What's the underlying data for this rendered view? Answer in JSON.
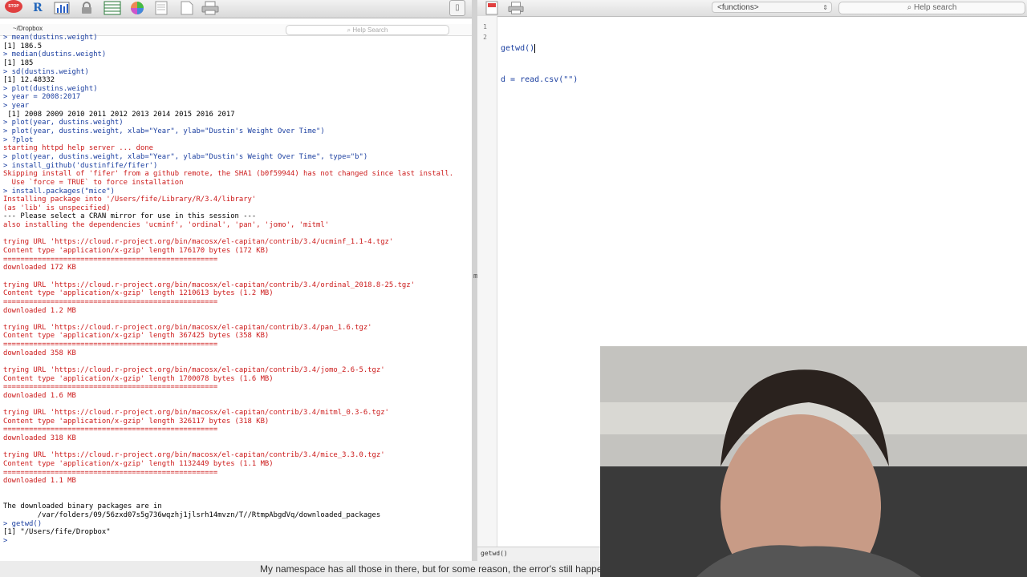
{
  "console_window": {
    "toolbar": {
      "icons": [
        "stop-icon",
        "r-logo-icon",
        "bar-chart-icon",
        "lock-icon",
        "table-icon",
        "color-wheel-icon",
        "script-icon",
        "new-document-icon",
        "print-icon"
      ],
      "stop_label": "STOP",
      "r_label": "R"
    },
    "path": "~/Dropbox",
    "help_search_placeholder": "Help Search",
    "lines": [
      {
        "t": "> mean(dustins.weight)",
        "k": "in"
      },
      {
        "t": "[1] 186.5",
        "k": "out"
      },
      {
        "t": "> median(dustins.weight)",
        "k": "in"
      },
      {
        "t": "[1] 185",
        "k": "out"
      },
      {
        "t": "> sd(dustins.weight)",
        "k": "in"
      },
      {
        "t": "[1] 12.48332",
        "k": "out"
      },
      {
        "t": "> plot(dustins.weight)",
        "k": "in"
      },
      {
        "t": "> year = 2008:2017",
        "k": "in"
      },
      {
        "t": "> year",
        "k": "in"
      },
      {
        "t": " [1] 2008 2009 2010 2011 2012 2013 2014 2015 2016 2017",
        "k": "out"
      },
      {
        "t": "> plot(year, dustins.weight)",
        "k": "in"
      },
      {
        "t": "> plot(year, dustins.weight, xlab=\"Year\", ylab=\"Dustin's Weight Over Time\")",
        "k": "in"
      },
      {
        "t": "> ?plot",
        "k": "in"
      },
      {
        "t": "starting httpd help server ... done",
        "k": "err"
      },
      {
        "t": "> plot(year, dustins.weight, xlab=\"Year\", ylab=\"Dustin's Weight Over Time\", type=\"b\")",
        "k": "in"
      },
      {
        "t": "> install_github('dustinfife/fifer')",
        "k": "in"
      },
      {
        "t": "Skipping install of 'fifer' from a github remote, the SHA1 (b0f59944) has not changed since last install.",
        "k": "err"
      },
      {
        "t": "  Use `force = TRUE` to force installation",
        "k": "err"
      },
      {
        "t": "> install.packages(\"mice\")",
        "k": "in"
      },
      {
        "t": "Installing package into '/Users/fife/Library/R/3.4/library'",
        "k": "err"
      },
      {
        "t": "(as 'lib' is unspecified)",
        "k": "err"
      },
      {
        "t": "--- Please select a CRAN mirror for use in this session ---",
        "k": "out"
      },
      {
        "t": "also installing the dependencies 'ucminf', 'ordinal', 'pan', 'jomo', 'mitml'",
        "k": "err"
      },
      {
        "t": "",
        "k": "out"
      },
      {
        "t": "trying URL 'https://cloud.r-project.org/bin/macosx/el-capitan/contrib/3.4/ucminf_1.1-4.tgz'",
        "k": "err"
      },
      {
        "t": "Content type 'application/x-gzip' length 176170 bytes (172 KB)",
        "k": "err"
      },
      {
        "t": "==================================================",
        "k": "err"
      },
      {
        "t": "downloaded 172 KB",
        "k": "err"
      },
      {
        "t": "",
        "k": "out"
      },
      {
        "t": "trying URL 'https://cloud.r-project.org/bin/macosx/el-capitan/contrib/3.4/ordinal_2018.8-25.tgz'",
        "k": "err"
      },
      {
        "t": "Content type 'application/x-gzip' length 1210613 bytes (1.2 MB)",
        "k": "err"
      },
      {
        "t": "==================================================",
        "k": "err"
      },
      {
        "t": "downloaded 1.2 MB",
        "k": "err"
      },
      {
        "t": "",
        "k": "out"
      },
      {
        "t": "trying URL 'https://cloud.r-project.org/bin/macosx/el-capitan/contrib/3.4/pan_1.6.tgz'",
        "k": "err"
      },
      {
        "t": "Content type 'application/x-gzip' length 367425 bytes (358 KB)",
        "k": "err"
      },
      {
        "t": "==================================================",
        "k": "err"
      },
      {
        "t": "downloaded 358 KB",
        "k": "err"
      },
      {
        "t": "",
        "k": "out"
      },
      {
        "t": "trying URL 'https://cloud.r-project.org/bin/macosx/el-capitan/contrib/3.4/jomo_2.6-5.tgz'",
        "k": "err"
      },
      {
        "t": "Content type 'application/x-gzip' length 1700078 bytes (1.6 MB)",
        "k": "err"
      },
      {
        "t": "==================================================",
        "k": "err"
      },
      {
        "t": "downloaded 1.6 MB",
        "k": "err"
      },
      {
        "t": "",
        "k": "out"
      },
      {
        "t": "trying URL 'https://cloud.r-project.org/bin/macosx/el-capitan/contrib/3.4/mitml_0.3-6.tgz'",
        "k": "err"
      },
      {
        "t": "Content type 'application/x-gzip' length 326117 bytes (318 KB)",
        "k": "err"
      },
      {
        "t": "==================================================",
        "k": "err"
      },
      {
        "t": "downloaded 318 KB",
        "k": "err"
      },
      {
        "t": "",
        "k": "out"
      },
      {
        "t": "trying URL 'https://cloud.r-project.org/bin/macosx/el-capitan/contrib/3.4/mice_3.3.0.tgz'",
        "k": "err"
      },
      {
        "t": "Content type 'application/x-gzip' length 1132449 bytes (1.1 MB)",
        "k": "err"
      },
      {
        "t": "==================================================",
        "k": "err"
      },
      {
        "t": "downloaded 1.1 MB",
        "k": "err"
      },
      {
        "t": "",
        "k": "out"
      },
      {
        "t": "",
        "k": "out"
      },
      {
        "t": "The downloaded binary packages are in",
        "k": "out"
      },
      {
        "t": "\t/var/folders/09/56zxd07s5g736wqzhj1jlsrh14mvzn/T//RtmpAbgdVq/downloaded_packages",
        "k": "out"
      },
      {
        "t": "> getwd()",
        "k": "in"
      },
      {
        "t": "[1] \"/Users/fife/Dropbox\"",
        "k": "out"
      },
      {
        "t": ">",
        "k": "in"
      }
    ]
  },
  "divider": {
    "glyph": "m"
  },
  "editor_window": {
    "toolbar_icons": [
      "source-icon",
      "print-icon"
    ],
    "functions_dropdown": "<functions>",
    "functions_arrow": "⇕",
    "help_search_placeholder": "Help search",
    "gutter_numbers": [
      "1",
      "2"
    ],
    "code_lines": [
      "getwd()",
      "d = read.csv(\"\")"
    ],
    "status_text": "getwd()"
  },
  "subtitle": "My namespace has all those in there, but for some reason, the error's still happening.",
  "colors": {
    "console_input": "#1b3fa0",
    "console_output": "#000000",
    "console_message": "#cc1a1a"
  }
}
